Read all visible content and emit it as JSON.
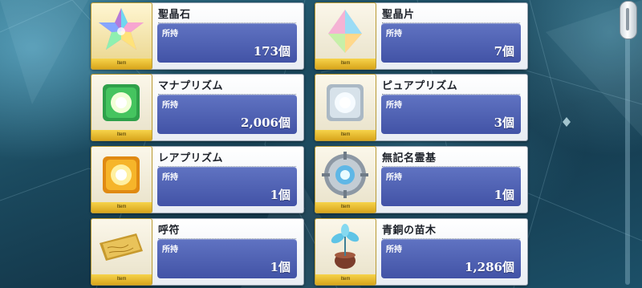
{
  "labels": {
    "owned": "所持",
    "item_tag": "Item"
  },
  "items": [
    {
      "name": "聖晶石",
      "count": "173個",
      "icon": "saint-quartz-icon"
    },
    {
      "name": "聖晶片",
      "count": "7個",
      "icon": "quartz-fragment-icon"
    },
    {
      "name": "マナプリズム",
      "count": "2,006個",
      "icon": "mana-prism-icon"
    },
    {
      "name": "ピュアプリズム",
      "count": "3個",
      "icon": "pure-prism-icon"
    },
    {
      "name": "レアプリズム",
      "count": "1個",
      "icon": "rare-prism-icon"
    },
    {
      "name": "無記名霊基",
      "count": "1個",
      "icon": "unregistered-spirit-origin-icon"
    },
    {
      "name": "呼符",
      "count": "1個",
      "icon": "summon-ticket-icon"
    },
    {
      "name": "青銅の苗木",
      "count": "1,286個",
      "icon": "bronze-sapling-icon"
    }
  ]
}
